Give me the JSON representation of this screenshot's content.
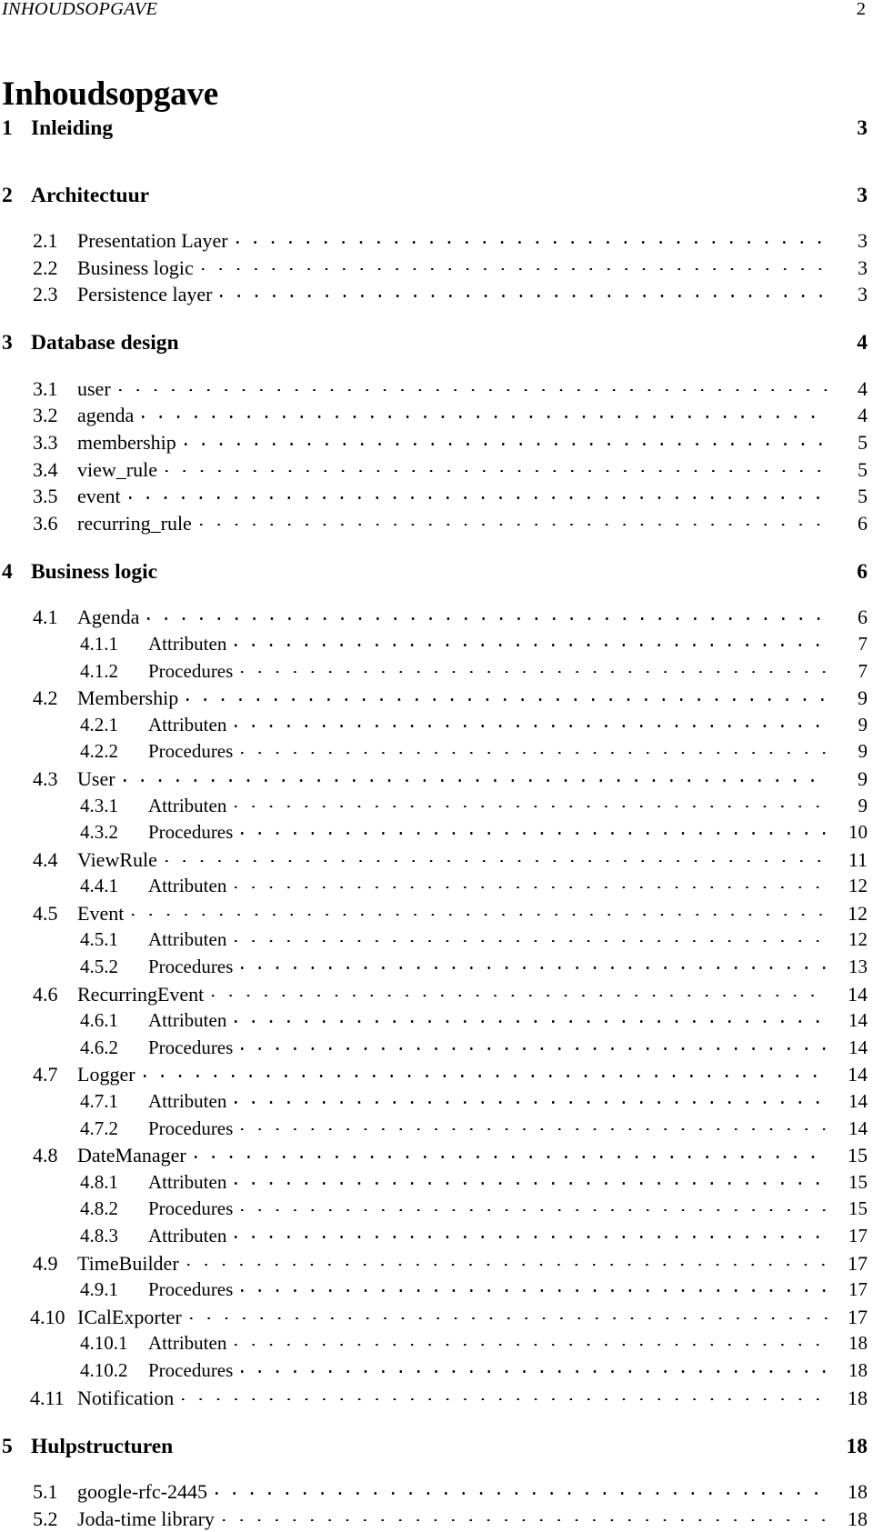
{
  "header": {
    "running_title": "INHOUDSOPGAVE",
    "page_number": "2"
  },
  "title": "Inhoudsopgave",
  "toc": {
    "entries": [
      {
        "level": 1,
        "number": "1",
        "title": "Inleiding",
        "page": "3"
      },
      {
        "level": 1,
        "number": "2",
        "title": "Architectuur",
        "page": "3"
      },
      {
        "level": 2,
        "number": "2.1",
        "title": "Presentation Layer",
        "page": "3"
      },
      {
        "level": 2,
        "number": "2.2",
        "title": "Business logic",
        "page": "3"
      },
      {
        "level": 2,
        "number": "2.3",
        "title": "Persistence layer",
        "page": "3"
      },
      {
        "level": 1,
        "number": "3",
        "title": "Database design",
        "page": "4"
      },
      {
        "level": 2,
        "number": "3.1",
        "title": "user",
        "page": "4"
      },
      {
        "level": 2,
        "number": "3.2",
        "title": "agenda",
        "page": "4"
      },
      {
        "level": 2,
        "number": "3.3",
        "title": "membership",
        "page": "5"
      },
      {
        "level": 2,
        "number": "3.4",
        "title": "view_rule",
        "page": "5"
      },
      {
        "level": 2,
        "number": "3.5",
        "title": "event",
        "page": "5"
      },
      {
        "level": 2,
        "number": "3.6",
        "title": "recurring_rule",
        "page": "6"
      },
      {
        "level": 1,
        "number": "4",
        "title": "Business logic",
        "page": "6"
      },
      {
        "level": 2,
        "number": "4.1",
        "title": "Agenda",
        "page": "6"
      },
      {
        "level": 3,
        "number": "4.1.1",
        "title": "Attributen",
        "page": "7"
      },
      {
        "level": 3,
        "number": "4.1.2",
        "title": "Procedures",
        "page": "7"
      },
      {
        "level": 2,
        "number": "4.2",
        "title": "Membership",
        "page": "9"
      },
      {
        "level": 3,
        "number": "4.2.1",
        "title": "Attributen",
        "page": "9"
      },
      {
        "level": 3,
        "number": "4.2.2",
        "title": "Procedures",
        "page": "9"
      },
      {
        "level": 2,
        "number": "4.3",
        "title": "User",
        "page": "9"
      },
      {
        "level": 3,
        "number": "4.3.1",
        "title": "Attributen",
        "page": "9"
      },
      {
        "level": 3,
        "number": "4.3.2",
        "title": "Procedures",
        "page": "10"
      },
      {
        "level": 2,
        "number": "4.4",
        "title": "ViewRule",
        "page": "11"
      },
      {
        "level": 3,
        "number": "4.4.1",
        "title": "Attributen",
        "page": "12"
      },
      {
        "level": 2,
        "number": "4.5",
        "title": "Event",
        "page": "12"
      },
      {
        "level": 3,
        "number": "4.5.1",
        "title": "Attributen",
        "page": "12"
      },
      {
        "level": 3,
        "number": "4.5.2",
        "title": "Procedures",
        "page": "13"
      },
      {
        "level": 2,
        "number": "4.6",
        "title": "RecurringEvent",
        "page": "14"
      },
      {
        "level": 3,
        "number": "4.6.1",
        "title": "Attributen",
        "page": "14"
      },
      {
        "level": 3,
        "number": "4.6.2",
        "title": "Procedures",
        "page": "14"
      },
      {
        "level": 2,
        "number": "4.7",
        "title": "Logger",
        "page": "14"
      },
      {
        "level": 3,
        "number": "4.7.1",
        "title": "Attributen",
        "page": "14"
      },
      {
        "level": 3,
        "number": "4.7.2",
        "title": "Procedures",
        "page": "14"
      },
      {
        "level": 2,
        "number": "4.8",
        "title": "DateManager",
        "page": "15"
      },
      {
        "level": 3,
        "number": "4.8.1",
        "title": "Attributen",
        "page": "15"
      },
      {
        "level": 3,
        "number": "4.8.2",
        "title": "Procedures",
        "page": "15"
      },
      {
        "level": 3,
        "number": "4.8.3",
        "title": "Attributen",
        "page": "17"
      },
      {
        "level": 2,
        "number": "4.9",
        "title": "TimeBuilder",
        "page": "17"
      },
      {
        "level": 3,
        "number": "4.9.1",
        "title": "Procedures",
        "page": "17"
      },
      {
        "level": 2,
        "number": "4.10",
        "title": "ICalExporter",
        "page": "17"
      },
      {
        "level": 3,
        "number": "4.10.1",
        "title": "Attributen",
        "page": "18"
      },
      {
        "level": 3,
        "number": "4.10.2",
        "title": "Procedures",
        "page": "18"
      },
      {
        "level": 2,
        "number": "4.11",
        "title": "Notification",
        "page": "18"
      },
      {
        "level": 1,
        "number": "5",
        "title": "Hulpstructuren",
        "page": "18"
      },
      {
        "level": 2,
        "number": "5.1",
        "title": "google-rfc-2445",
        "page": "18"
      },
      {
        "level": 2,
        "number": "5.2",
        "title": "Joda-time library",
        "page": "18"
      }
    ]
  }
}
